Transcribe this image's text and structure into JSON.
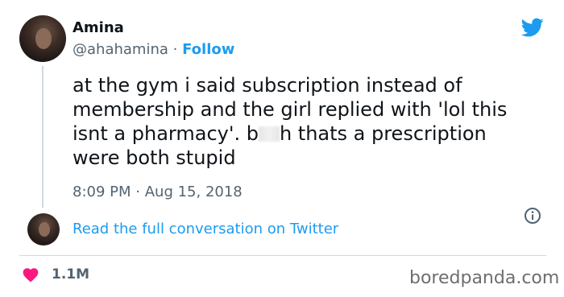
{
  "author": {
    "name": "Amina",
    "handle": "@ahahamina",
    "separator": "·",
    "follow_label": "Follow"
  },
  "tweet": {
    "lines": [
      "at the gym i said subscription instead of",
      "membership and the girl replied with 'lol this",
      "isnt a pharmacy'. b",
      "h thats a prescription",
      "were both stupid"
    ],
    "time": "8:09 PM",
    "separator": "·",
    "date": "Aug 15, 2018"
  },
  "read_link": "Read the full conversation on Twitter",
  "engagement": {
    "likes": "1.1M"
  },
  "watermark": "boredpanda.com",
  "icons": {
    "brand": "twitter-bird-icon",
    "info": "info-icon",
    "like": "heart-icon"
  },
  "colors": {
    "accent": "#1d9bf0",
    "like": "#f91880",
    "text": "#0f1419",
    "muted": "#536471"
  }
}
